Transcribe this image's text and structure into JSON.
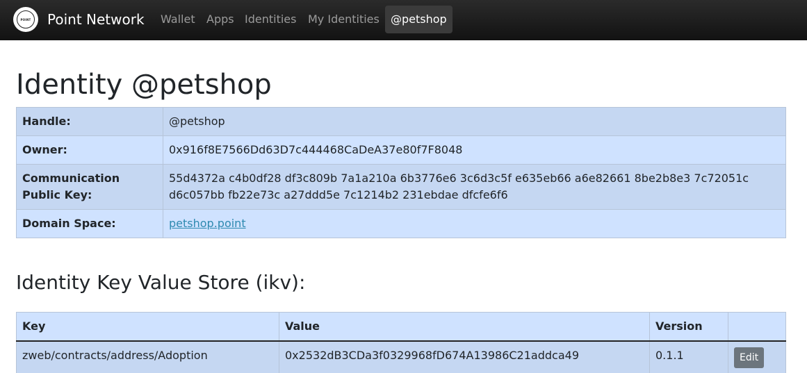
{
  "navbar": {
    "brand": "Point Network",
    "logo_text": "POINT",
    "links": [
      "Wallet",
      "Apps",
      "Identities",
      "My Identities"
    ],
    "active": "@petshop"
  },
  "page_title": "Identity @petshop",
  "identity": {
    "handle_label": "Handle:",
    "handle_value": "@petshop",
    "owner_label": "Owner:",
    "owner_value": "0x916f8E7566Dd63D7c444468CaDeA37e80f7F8048",
    "key_label": "Communication Public Key:",
    "key_value": "55d4372a c4b0df28 df3c809b 7a1a210a 6b3776e6 3c6d3c5f e635eb66 a6e82661 8be2b8e3 7c72051c d6c057bb fb22e73c a27ddd5e 7c1214b2 231ebdae dfcfe6f6",
    "domain_label": "Domain Space:",
    "domain_value": "petshop.point"
  },
  "ikv": {
    "title": "Identity Key Value Store (ikv):",
    "headers": {
      "key": "Key",
      "value": "Value",
      "version": "Version"
    },
    "rows": [
      {
        "key": "zweb/contracts/address/Adoption",
        "value": "0x2532dB3CDa3f0329968fD674A13986C21addca49",
        "version": "0.1.1",
        "action": "Edit"
      }
    ]
  }
}
